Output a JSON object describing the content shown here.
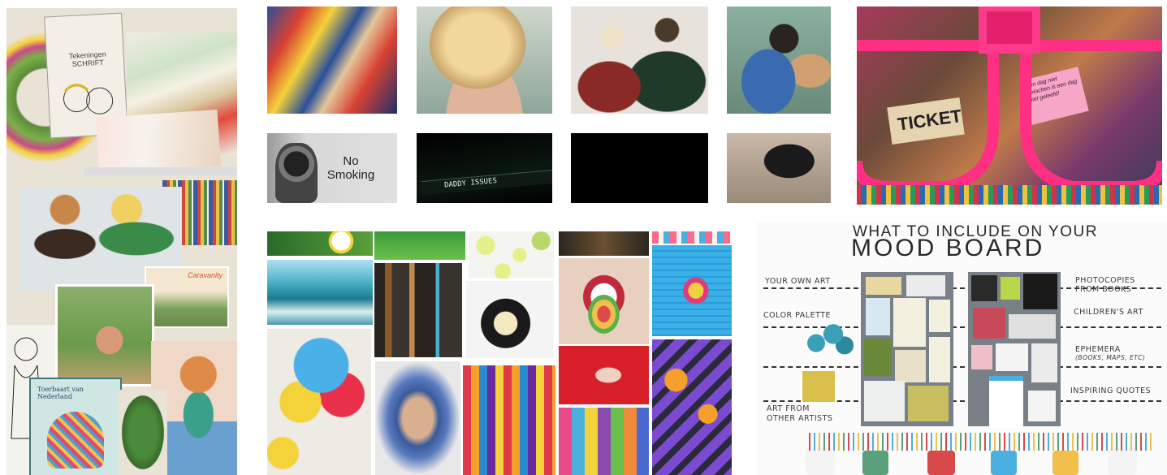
{
  "panels": {
    "magazine_collage": {
      "cover_text": "Tekeningen SCHRIFT",
      "note_text": "Caravanity",
      "book_title": "Toerbaart van Nederland"
    },
    "film_stills": {
      "no_smoking": "No Smoking",
      "tv_title": "DADDY ISSUES"
    },
    "sunglasses_collage": {
      "ticket": "TICKET",
      "note": "Een dag niet gelachen is een dag niet geleefd!"
    },
    "mood_board_infographic": {
      "title_line1": "WHAT TO INCLUDE ON YOUR",
      "title_line2": "MOOD BOARD",
      "left_labels": [
        "YOUR OWN ART",
        "COLOR PALETTE",
        "ART FROM",
        "OTHER ARTISTS"
      ],
      "right_labels": [
        "PHOTOCOPIES",
        "FROM BOOKS",
        "CHILDREN'S ART",
        "EPHEMERA",
        "(BOOKS, MAPS, ETC)",
        "INSPIRING QUOTES"
      ]
    }
  }
}
